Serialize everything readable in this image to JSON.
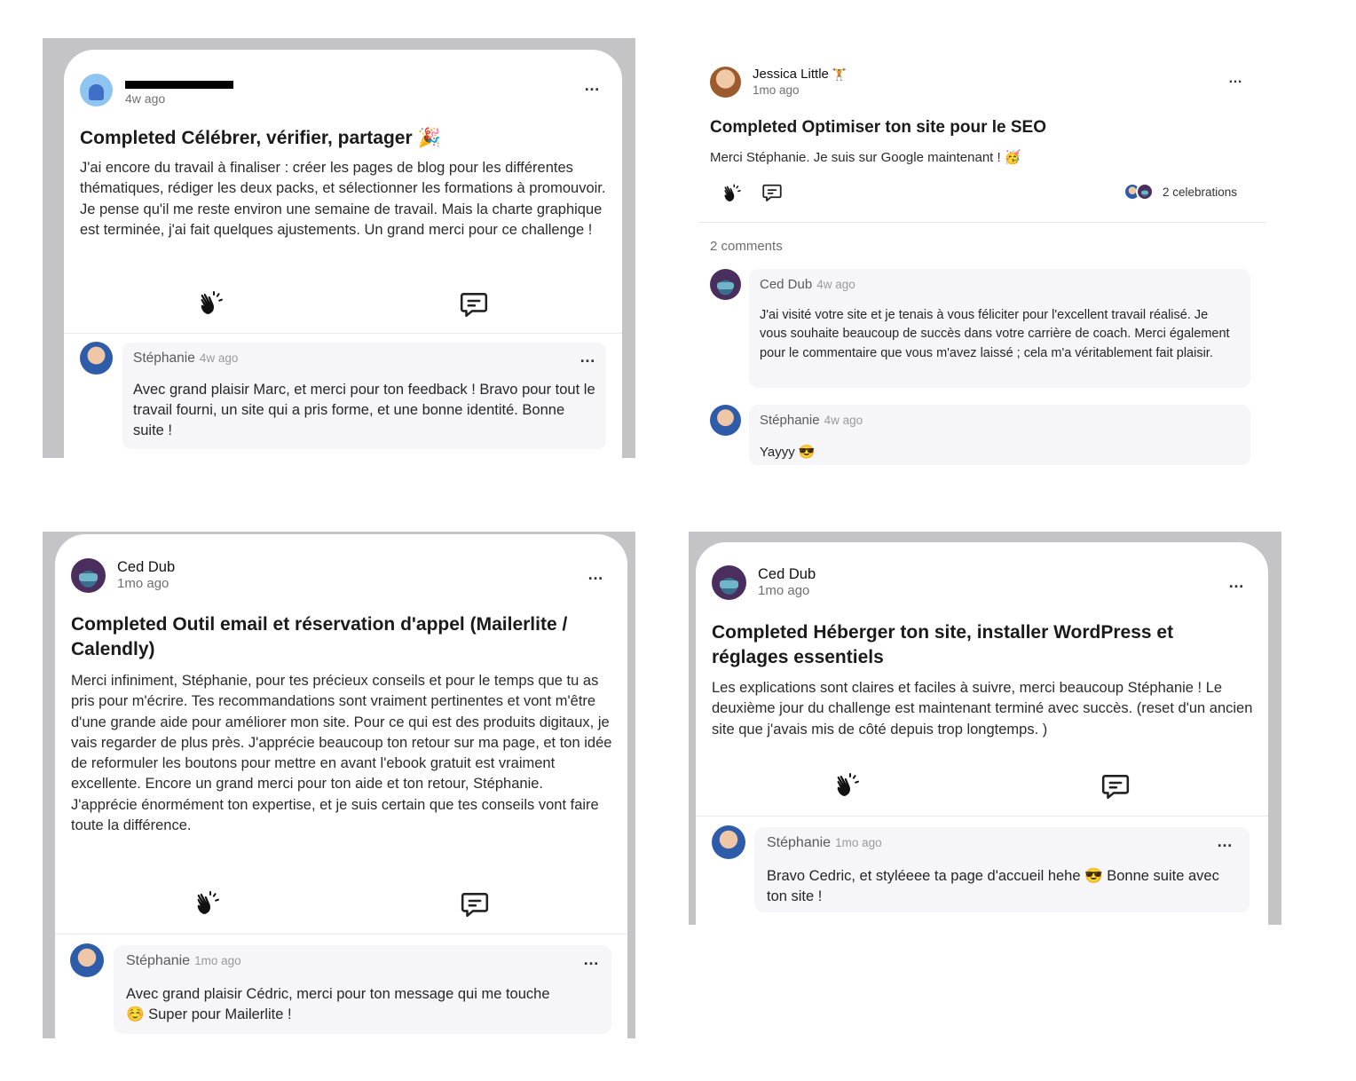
{
  "posts": [
    {
      "author": "",
      "time": "4w ago",
      "title": "Completed Célébrer, vérifier, partager",
      "title_emoji": "🎉",
      "body": "J'ai encore du travail à finaliser : créer les pages de blog pour les différentes thématiques, rédiger les deux packs, et sélectionner les formations à promouvoir. Je pense qu'il me reste environ une semaine de travail. Mais la charte graphique est terminée, j'ai fait quelques ajustements. Un grand merci pour ce challenge !",
      "comments": [
        {
          "author": "Stéphanie",
          "time": "4w ago",
          "text": "Avec grand plaisir Marc, et merci pour ton feedback ! Bravo pour tout le travail fourni, un site qui a pris forme, et une bonne identité. Bonne suite !"
        }
      ]
    },
    {
      "author": "Jessica Little",
      "author_badge": "🏋",
      "time": "1mo ago",
      "title": "Completed Optimiser ton site pour le SEO",
      "body": "Merci Stéphanie. Je suis sur Google maintenant ! 🥳",
      "celebrations": "2 celebrations",
      "comments_count": "2 comments",
      "comments": [
        {
          "author": "Ced Dub",
          "time": "4w ago",
          "text": "J'ai visité votre site et je tenais à vous féliciter pour l'excellent travail réalisé. Je vous souhaite beaucoup de succès dans votre carrière de coach. Merci également pour le commentaire que vous m'avez laissé ; cela m'a véritablement fait plaisir."
        },
        {
          "author": "Stéphanie",
          "time": "4w ago",
          "text": "Yayyy 😎"
        }
      ]
    },
    {
      "author": "Ced Dub",
      "time": "1mo ago",
      "title": "Completed Outil email et réservation d'appel (Mailerlite / Calendly)",
      "body": "Merci infiniment, Stéphanie, pour tes précieux conseils et pour le temps que tu as pris pour m'écrire. Tes recommandations sont vraiment pertinentes et vont m'être d'une grande aide pour améliorer mon site. Pour ce qui est des produits digitaux, je vais regarder de plus près. J'apprécie beaucoup ton retour sur ma page, et ton idée de reformuler les boutons pour mettre en avant l'ebook gratuit est vraiment excellente. Encore un grand merci pour ton aide et ton retour, Stéphanie. J'apprécie énormément ton expertise, et je suis certain que tes conseils vont faire toute la différence.",
      "comments": [
        {
          "author": "Stéphanie",
          "time": "1mo ago",
          "text": "Avec grand plaisir Cédric, merci pour ton message qui me touche ☺️ Super pour Mailerlite !"
        }
      ]
    },
    {
      "author": "Ced Dub",
      "time": "1mo ago",
      "title": "Completed Héberger ton site, installer WordPress et réglages essentiels",
      "body": "Les explications sont claires et faciles à suivre, merci beaucoup Stéphanie ! Le deuxième jour du challenge est maintenant terminé avec succès. (reset d'un ancien site que j'avais mis de côté depuis trop longtemps. )",
      "comments": [
        {
          "author": "Stéphanie",
          "time": "1mo ago",
          "text": "Bravo Cedric, et styléeee ta page d'accueil hehe 😎 Bonne suite avec ton site !"
        }
      ]
    }
  ],
  "icons": {
    "more": "…",
    "celebrate": "clap-icon",
    "comment": "comment-icon"
  }
}
